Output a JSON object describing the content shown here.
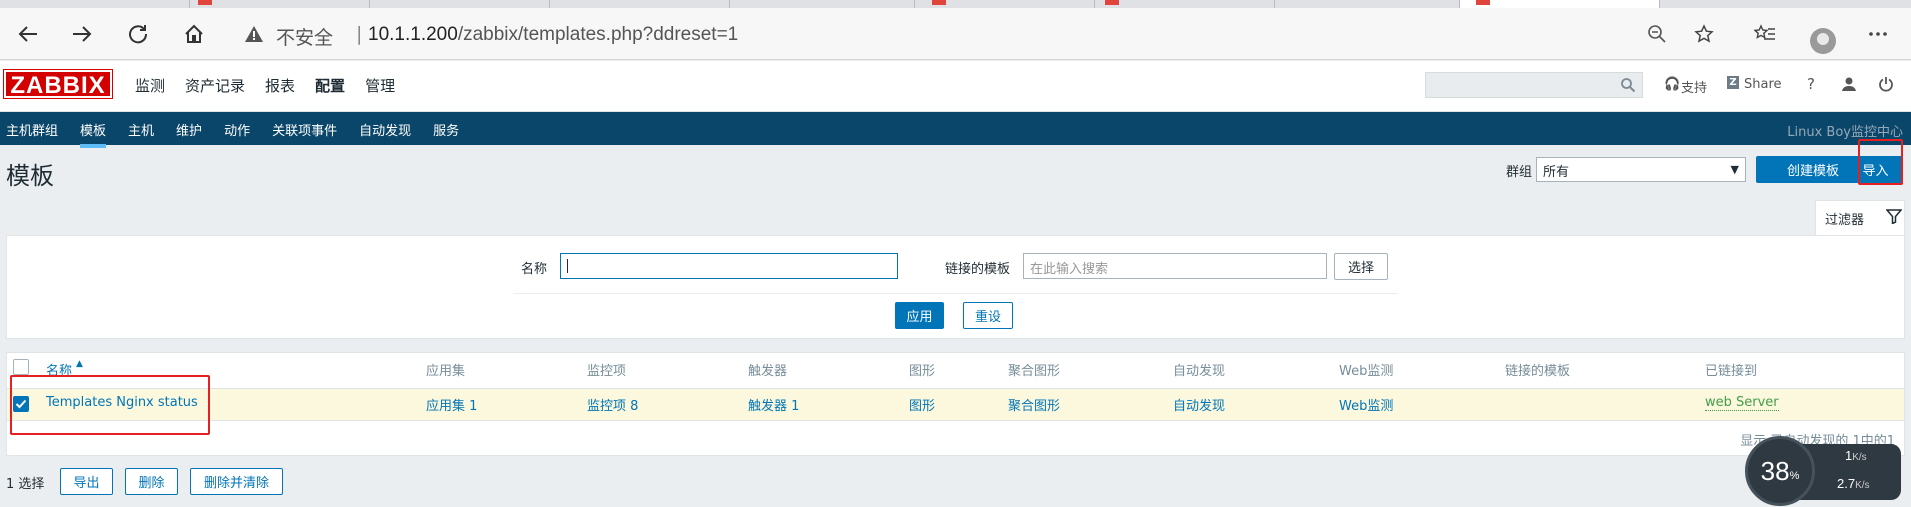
{
  "browser": {
    "security_label": "不安全",
    "url_host": "10.1.1.200",
    "url_path": "/zabbix/templates.php?ddreset=1"
  },
  "header": {
    "logo": "ZABBIX",
    "menu": [
      "监测",
      "资产记录",
      "报表",
      "配置",
      "管理"
    ],
    "support": "支持",
    "share": "Share",
    "help": "?"
  },
  "subnav": {
    "items": [
      "主机群组",
      "模板",
      "主机",
      "维护",
      "动作",
      "关联项事件",
      "自动发现",
      "服务"
    ],
    "right_text": "Linux Boy监控中心"
  },
  "page": {
    "title": "模板",
    "group_label": "群组",
    "group_value": "所有",
    "create_button": "创建模板",
    "import_button": "导入"
  },
  "filter": {
    "tab_label": "过滤器",
    "name_label": "名称",
    "name_value": "",
    "linked_label": "链接的模板",
    "linked_placeholder": "在此输入搜索",
    "select_button": "选择",
    "apply_button": "应用",
    "reset_button": "重设"
  },
  "table": {
    "headers": [
      "名称",
      "应用集",
      "监控项",
      "触发器",
      "图形",
      "聚合图形",
      "自动发现",
      "Web监测",
      "链接的模板",
      "已链接到"
    ],
    "rows": [
      {
        "name": "Templates Nginx status",
        "applications": "应用集",
        "applications_count": "1",
        "items": "监控项",
        "items_count": "8",
        "triggers": "触发器",
        "triggers_count": "1",
        "graphs": "图形",
        "screens": "聚合图形",
        "discovery": "自动发现",
        "web": "Web监测",
        "linked_templates": "",
        "linked_to": "web Server"
      }
    ],
    "footer": "显示 已自动发现的 1中的1"
  },
  "actions": {
    "selected": "1 选择",
    "export": "导出",
    "delete": "删除",
    "delete_clear": "删除并清除"
  },
  "speed_widget": {
    "percent": "38",
    "percent_unit": "%",
    "up": "1",
    "down": "2.7",
    "unit": "K/s"
  }
}
